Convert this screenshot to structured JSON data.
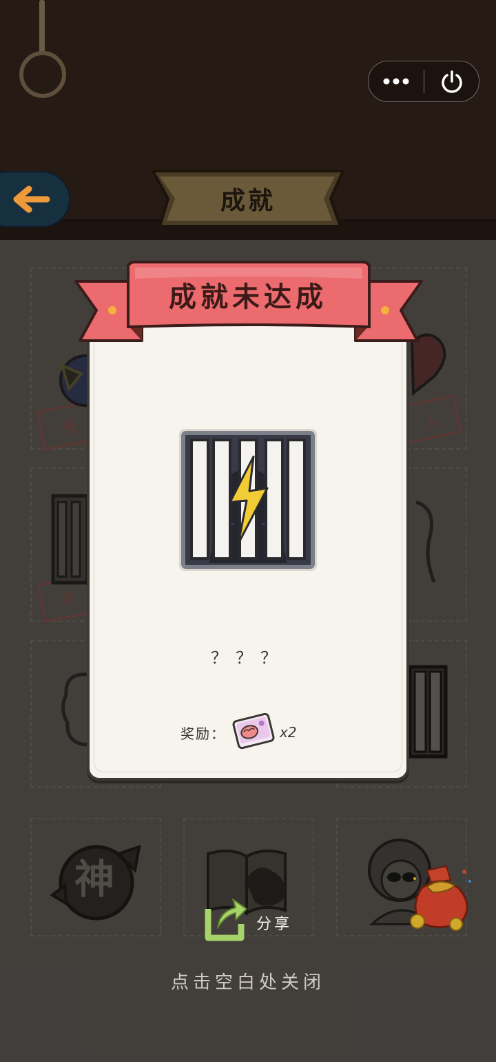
{
  "header": {
    "title": "成就",
    "back_icon": "arrow-left-icon",
    "more_icon": "more-dots-icon",
    "power_icon": "power-icon"
  },
  "background": {
    "partial_labels": [
      "夜",
      "人",
      "身"
    ],
    "god_badge_char": "神"
  },
  "modal": {
    "title": "成就未达成",
    "achievement_name": "？？？",
    "reward_label": "奖励：",
    "reward_count": "x2",
    "reward_icon": "brain-card-icon",
    "locked_icon": "locked-cage-icon"
  },
  "share": {
    "label": "分享",
    "icon": "share-arrow-icon"
  },
  "close_hint": "点击空白处关闭",
  "colors": {
    "ribbon_red": "#ec6b6e",
    "ribbon_dark": "#b94a4b",
    "card_bg": "#f6f4ed",
    "header_bg": "#261a14",
    "back_button": "#173040",
    "bolt_yellow": "#f1cc35"
  }
}
